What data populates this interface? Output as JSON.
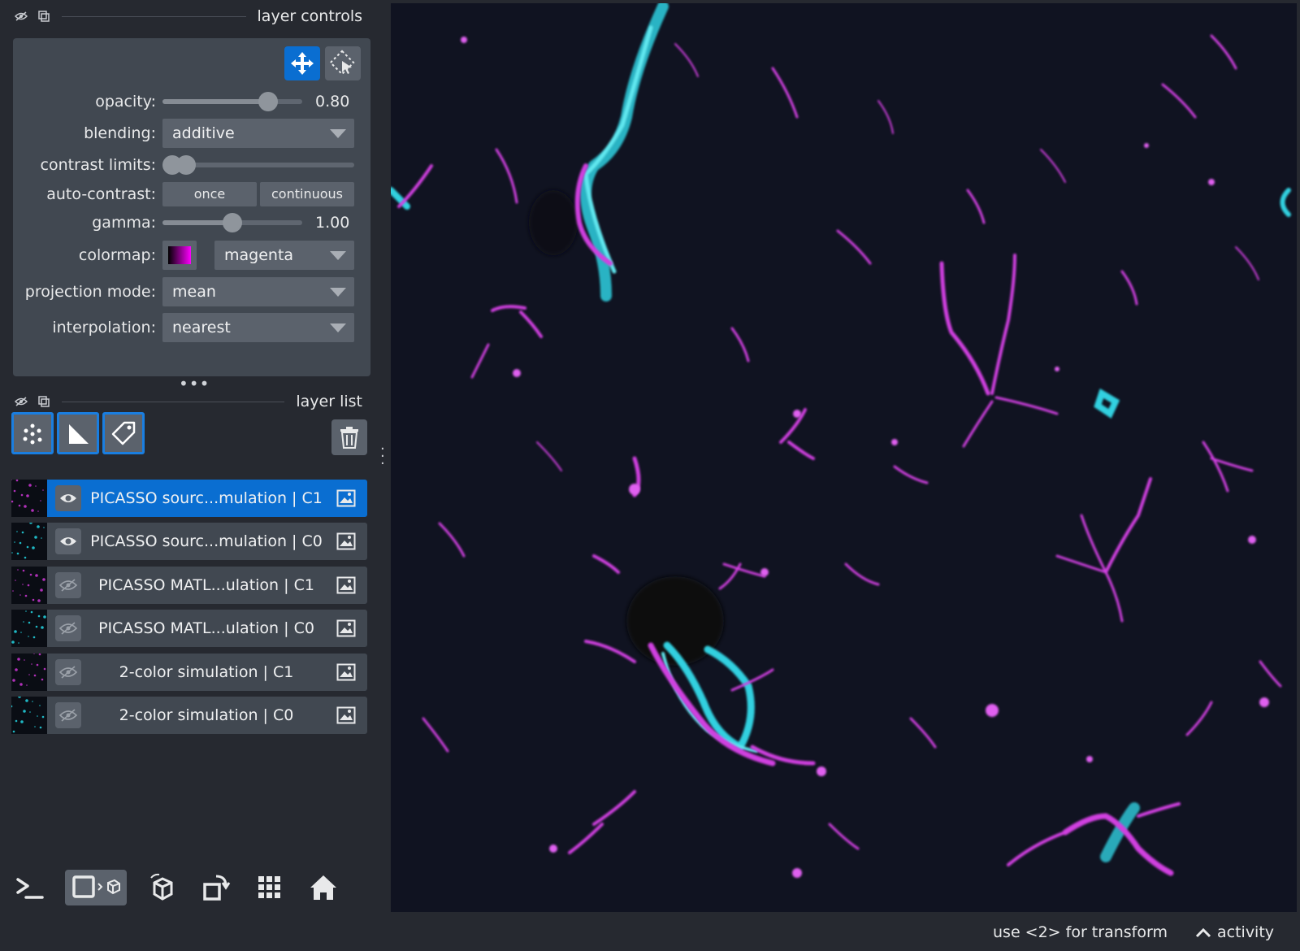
{
  "layer_controls": {
    "title": "layer controls",
    "opacity_label": "opacity:",
    "opacity_value": "0.80",
    "opacity_fraction": 0.8,
    "blending_label": "blending:",
    "blending_value": "additive",
    "contrast_label": "contrast limits:",
    "contrast_low_fraction": 0.0,
    "contrast_high_fraction": 0.08,
    "autocontrast_label": "auto-contrast:",
    "autocontrast_once": "once",
    "autocontrast_continuous": "continuous",
    "gamma_label": "gamma:",
    "gamma_value": "1.00",
    "gamma_fraction": 0.5,
    "colormap_label": "colormap:",
    "colormap_value": "magenta",
    "projection_label": "projection mode:",
    "projection_value": "mean",
    "interpolation_label": "interpolation:",
    "interpolation_value": "nearest"
  },
  "layer_list": {
    "title": "layer list",
    "layers": [
      {
        "name": "PICASSO sourc...mulation | C1",
        "visible": true,
        "selected": true,
        "color": "#b030b8"
      },
      {
        "name": "PICASSO sourc...mulation | C0",
        "visible": true,
        "selected": false,
        "color": "#1fb8c4"
      },
      {
        "name": "PICASSO MATL...ulation | C1",
        "visible": false,
        "selected": false,
        "color": "#b030b8"
      },
      {
        "name": "PICASSO MATL...ulation | C0",
        "visible": false,
        "selected": false,
        "color": "#1fb8c4"
      },
      {
        "name": "2-color simulation | C1",
        "visible": false,
        "selected": false,
        "color": "#b030b8"
      },
      {
        "name": "2-color simulation | C0",
        "visible": false,
        "selected": false,
        "color": "#1fb8c4"
      }
    ]
  },
  "status": {
    "hint": "use <2> for transform",
    "activity": "activity"
  },
  "colors": {
    "accent": "#0a6ed1",
    "magenta": "#d040e0",
    "cyan": "#30d0e0"
  }
}
